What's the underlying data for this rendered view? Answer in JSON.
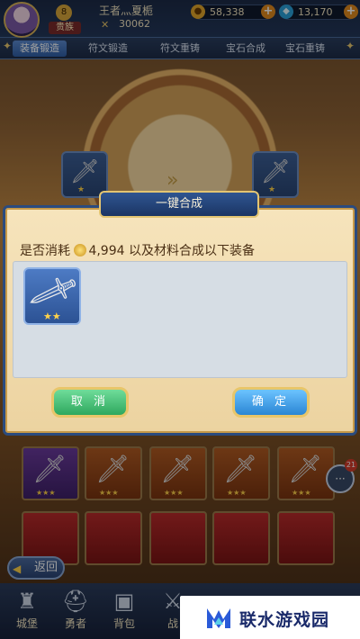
{
  "player": {
    "name": "王者灬夏栀",
    "power": "30062",
    "vip_label": "贵族",
    "level": "8"
  },
  "resources": [
    {
      "icon": "coin-icon",
      "value": "58,338"
    },
    {
      "icon": "diamond-icon",
      "value": "13,170"
    }
  ],
  "tabs": [
    {
      "label": "装备锻造",
      "active": true
    },
    {
      "label": "符文锻造",
      "active": false
    },
    {
      "label": "符文重铸",
      "active": false
    },
    {
      "label": "宝石合成",
      "active": false
    },
    {
      "label": "宝石重铸",
      "active": false
    }
  ],
  "dialog": {
    "title": "一键合成",
    "prompt_prefix": "是否消耗",
    "cost": "4,994",
    "prompt_suffix": "以及材料合成以下装备",
    "cancel_label": "取 消",
    "confirm_label": "确 定",
    "item_stars": "★★"
  },
  "back_label": "返回",
  "chat_badge": "21",
  "bottom_nav": [
    "城堡",
    "勇者",
    "背包",
    "战"
  ],
  "watermark": "联水游戏园",
  "colors": {
    "accent": "#2b4b7e",
    "cancel": "#2ea85e",
    "confirm": "#2a86d4",
    "panel": "#f6e4bc"
  }
}
